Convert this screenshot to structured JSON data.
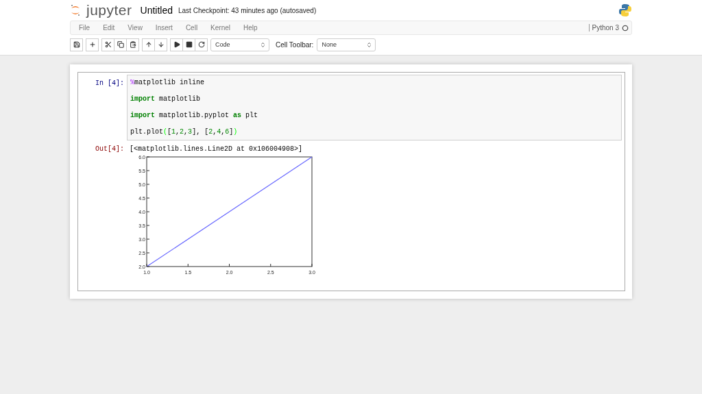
{
  "header": {
    "logo": "jupyter",
    "notebook_name": "Untitled",
    "checkpoint": "Last Checkpoint: 43 minutes ago (autosaved)"
  },
  "menu": [
    "File",
    "Edit",
    "View",
    "Insert",
    "Cell",
    "Kernel",
    "Help"
  ],
  "kernel": {
    "name": "Python 3",
    "busy": false
  },
  "toolbar": {
    "groups": [
      [
        {
          "kind": "save"
        }
      ],
      [
        {
          "kind": "add"
        }
      ],
      [
        {
          "kind": "cut"
        },
        {
          "kind": "copy"
        },
        {
          "kind": "paste"
        }
      ],
      [
        {
          "kind": "up"
        },
        {
          "kind": "down"
        }
      ],
      [
        {
          "kind": "run"
        },
        {
          "kind": "stop"
        },
        {
          "kind": "restart"
        }
      ]
    ],
    "cell_type": "Code",
    "cell_toolbar_label": "Cell Toolbar:",
    "cell_toolbar": "None"
  },
  "cell": {
    "in_prompt": "In [4]:",
    "out_prompt": "Out[4]:",
    "lines": [
      [
        {
          "kind": "magic",
          "text": "%"
        },
        {
          "kind": "plain",
          "text": "matplotlib inline"
        }
      ],
      [
        {
          "kind": "keyword",
          "text": "import"
        },
        {
          "kind": "plain",
          "text": " matplotlib"
        }
      ],
      [
        {
          "kind": "keyword",
          "text": "import"
        },
        {
          "kind": "plain",
          "text": " matplotlib.pyplot "
        },
        {
          "kind": "keyword",
          "text": "as"
        },
        {
          "kind": "plain",
          "text": " plt"
        }
      ],
      [
        {
          "kind": "plain",
          "text": "plt.plot"
        },
        {
          "kind": "paren",
          "text": "("
        },
        {
          "kind": "plain",
          "text": "["
        },
        {
          "kind": "number",
          "text": "1"
        },
        {
          "kind": "plain",
          "text": ","
        },
        {
          "kind": "number",
          "text": "2"
        },
        {
          "kind": "plain",
          "text": ","
        },
        {
          "kind": "number",
          "text": "3"
        },
        {
          "kind": "plain",
          "text": "], ["
        },
        {
          "kind": "number",
          "text": "2"
        },
        {
          "kind": "plain",
          "text": ","
        },
        {
          "kind": "number",
          "text": "4"
        },
        {
          "kind": "plain",
          "text": ","
        },
        {
          "kind": "number",
          "text": "6"
        },
        {
          "kind": "plain",
          "text": "]"
        },
        {
          "kind": "paren",
          "text": ")"
        }
      ]
    ],
    "output_text": "[<matplotlib.lines.Line2D at 0x106004908>]",
    "chart_data": {
      "type": "line",
      "x": [
        1,
        2,
        3
      ],
      "series": [
        {
          "color": "#6666ff",
          "values": [
            2,
            4,
            6
          ]
        }
      ],
      "xlim": [
        1,
        3
      ],
      "ylim": [
        2,
        6
      ],
      "xticks": [
        {
          "value": 1,
          "label": "1.0"
        },
        {
          "value": 1.5,
          "label": "1.5"
        },
        {
          "value": 2,
          "label": "2.0"
        },
        {
          "value": 2.5,
          "label": "2.5"
        },
        {
          "value": 3,
          "label": "3.0"
        }
      ],
      "yticks": [
        {
          "value": 2,
          "label": "2.0"
        },
        {
          "value": 2.5,
          "label": "2.5"
        },
        {
          "value": 3,
          "label": "3.0"
        },
        {
          "value": 3.5,
          "label": "3.5"
        },
        {
          "value": 4,
          "label": "4.0"
        },
        {
          "value": 4.5,
          "label": "4.5"
        },
        {
          "value": 5,
          "label": "5.0"
        },
        {
          "value": 5.5,
          "label": "5.5"
        },
        {
          "value": 6,
          "label": "6.0"
        }
      ]
    }
  }
}
